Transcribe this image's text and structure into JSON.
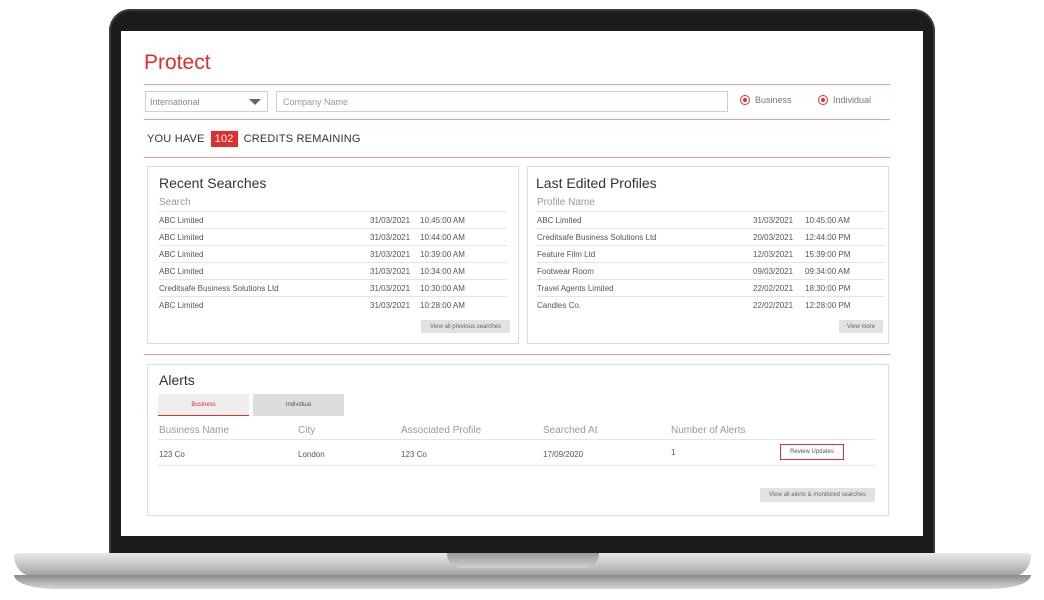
{
  "page": {
    "title": "Protect"
  },
  "search": {
    "country_value": "International",
    "company_placeholder": "Company Name",
    "radio_business_label": "Business",
    "radio_individual_label": "Individual"
  },
  "credits": {
    "prefix": "YOU HAVE",
    "count": "102",
    "suffix": "CREDITS REMAINING"
  },
  "recent_searches": {
    "title": "Recent Searches",
    "column_header": "Search",
    "rows": [
      {
        "name": "ABC Limited",
        "date": "31/03/2021",
        "time": "10:45:00 AM"
      },
      {
        "name": "ABC Limited",
        "date": "31/03/2021",
        "time": "10:44:00 AM"
      },
      {
        "name": "ABC Limited",
        "date": "31/03/2021",
        "time": "10:39:00 AM"
      },
      {
        "name": "ABC Limited",
        "date": "31/03/2021",
        "time": "10:34:00 AM"
      },
      {
        "name": "Creditsafe Business Solutions Ltd",
        "date": "31/03/2021",
        "time": "10:30:00 AM"
      },
      {
        "name": "ABC Limited",
        "date": "31/03/2021",
        "time": "10:28:00 AM"
      }
    ],
    "view_all_label": "View all previous searches"
  },
  "last_edited": {
    "title": "Last Edited Profiles",
    "column_header": "Profile Name",
    "rows": [
      {
        "name": "ABC Limited",
        "date": "31/03/2021",
        "time": "10:45:00 AM"
      },
      {
        "name": "Creditsafe Business Solutions Ltd",
        "date": "20/03/2021",
        "time": "12:44:00 PM"
      },
      {
        "name": "Feature Film Ltd",
        "date": "12/03/2021",
        "time": "15:39:00 PM"
      },
      {
        "name": "Footwear Room",
        "date": "09/03/2021",
        "time": "09:34:00 AM"
      },
      {
        "name": "Travel Agents Limited",
        "date": "22/02/2021",
        "time": "18:30:00 PM"
      },
      {
        "name": "Candles Co.",
        "date": "22/02/2021",
        "time": "12:28:00 PM"
      }
    ],
    "view_more_label": "View more"
  },
  "alerts": {
    "title": "Alerts",
    "tabs": {
      "business": "Business",
      "individual": "Individual"
    },
    "headers": {
      "business_name": "Business Name",
      "city": "City",
      "associated_profile": "Associated Profile",
      "searched_at": "Searched At",
      "number_of_alerts": "Number of Alerts"
    },
    "row": {
      "business_name": "123 Co",
      "city": "London",
      "associated_profile": "123 Co",
      "searched_at": "17/09/2020",
      "number_of_alerts": "1"
    },
    "review_label": "Review Updates",
    "view_all_label": "View all alerts & monitored searches"
  },
  "colors": {
    "accent": "#e02d2d",
    "frame": "#1c1c1c",
    "panel_border": "#dcdcdc"
  }
}
